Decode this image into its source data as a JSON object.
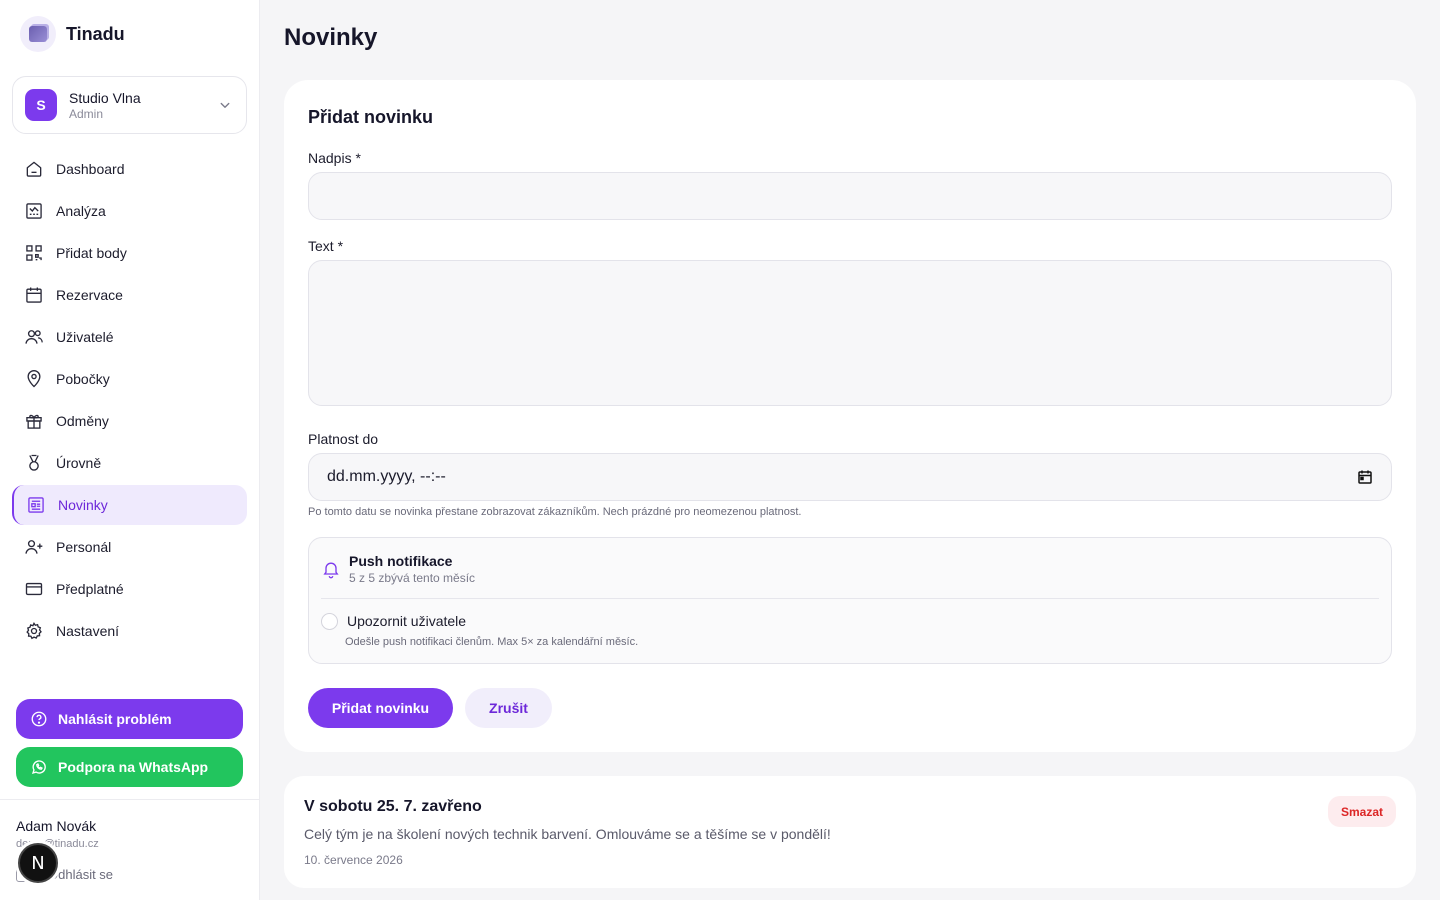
{
  "brand": {
    "name": "Tinadu",
    "logo_icon": "cube-logo-icon"
  },
  "org": {
    "avatar_letter": "S",
    "name": "Studio Vlna",
    "role": "Admin"
  },
  "nav": {
    "items": [
      {
        "label": "Dashboard",
        "icon": "home-icon"
      },
      {
        "label": "Analýza",
        "icon": "analytics-icon"
      },
      {
        "label": "Přidat body",
        "icon": "qr-code-icon"
      },
      {
        "label": "Rezervace",
        "icon": "calendar-icon"
      },
      {
        "label": "Uživatelé",
        "icon": "users-icon"
      },
      {
        "label": "Pobočky",
        "icon": "map-pin-icon"
      },
      {
        "label": "Odměny",
        "icon": "gift-icon"
      },
      {
        "label": "Úrovně",
        "icon": "medal-icon"
      },
      {
        "label": "Novinky",
        "icon": "newspaper-icon",
        "active": true
      },
      {
        "label": "Personál",
        "icon": "user-plus-icon"
      },
      {
        "label": "Předplatné",
        "icon": "credit-card-icon"
      },
      {
        "label": "Nastavení",
        "icon": "gear-icon"
      }
    ]
  },
  "support": {
    "report_label": "Nahlásit problém",
    "whatsapp_label": "Podpora na WhatsApp"
  },
  "user": {
    "name": "Adam Novák",
    "email": "demo@tinadu.cz",
    "logout_label": "Odhlásit se",
    "floating_badge": "N"
  },
  "page": {
    "title": "Novinky"
  },
  "form": {
    "title": "Přidat novinku",
    "heading_label": "Nadpis *",
    "heading_value": "",
    "text_label": "Text *",
    "text_value": "",
    "valid_until_label": "Platnost do",
    "valid_until_placeholder": "dd.mm.yyyy, --:--",
    "valid_until_hint": "Po tomto datu se novinka přestane zobrazovat zákazníkům. Nech prázdné pro neomezenou platnost.",
    "push": {
      "title": "Push notifikace",
      "quota": "5 z 5 zbývá tento měsíc",
      "notify_label": "Upozornit uživatele",
      "notify_checked": false,
      "notify_hint": "Odešle push notifikaci členům. Max 5× za kalendářní měsíc."
    },
    "submit_label": "Přidat novinku",
    "cancel_label": "Zrušit"
  },
  "news": [
    {
      "title": "V sobotu 25. 7. zavřeno",
      "text": "Celý tým je na školení nových technik barvení. Omlouváme se a těšíme se v pondělí!",
      "date": "10. července 2026",
      "delete_label": "Smazat"
    }
  ],
  "colors": {
    "accent": "#7c3aed",
    "whatsapp": "#22c55e",
    "danger": "#dc2626"
  }
}
